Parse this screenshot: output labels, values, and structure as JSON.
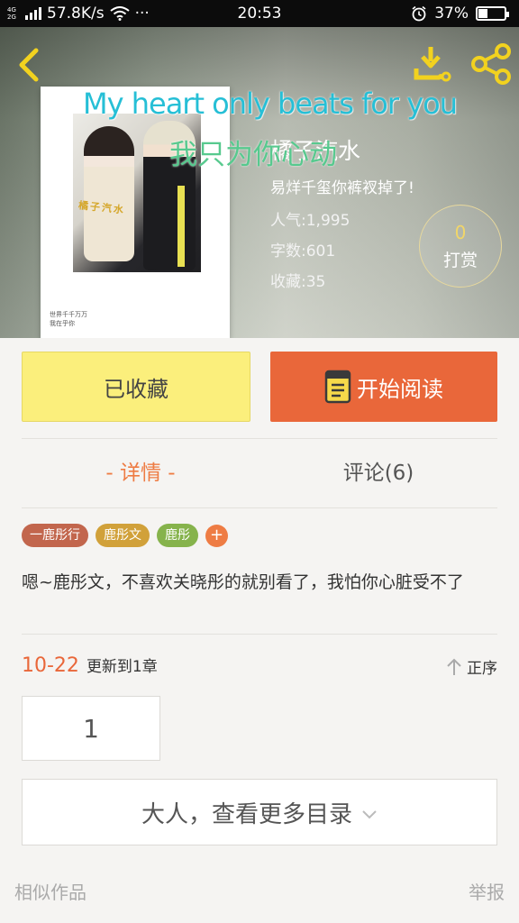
{
  "status_bar": {
    "network_labels": [
      "4G",
      "2G"
    ],
    "speed": "57.8K/s",
    "dots": "···",
    "time": "20:53",
    "battery": "37%",
    "battery_level": 0.37
  },
  "header": {
    "overlay_text_en": "My heart only beats for you",
    "overlay_text_cn": "我只为你心动",
    "title": "橘子汽水",
    "author": "易烊千玺你裤衩掉了!",
    "stats": [
      {
        "label": "人气:",
        "value": "1,995"
      },
      {
        "label": "字数:",
        "value": "601"
      },
      {
        "label": "收藏:",
        "value": "35"
      }
    ],
    "reward": {
      "count": "0",
      "label": "打赏"
    },
    "cover_caption": [
      "世界千千万万",
      "我在乎你"
    ],
    "cover_title": "橘子汽水"
  },
  "actions": {
    "favorite_label": "已收藏",
    "read_label": "开始阅读"
  },
  "tabs": {
    "detail": "- 详情 -",
    "comments": "评论(6)"
  },
  "tags": [
    {
      "label": "一鹿彤行",
      "color": "#c2664d"
    },
    {
      "label": "鹿彤文",
      "color": "#d1a13a"
    },
    {
      "label": "鹿彤",
      "color": "#86b34c"
    }
  ],
  "tag_add": "+",
  "description": "嗯~鹿彤文，不喜欢关晓彤的就别看了，我怕你心脏受不了",
  "update": {
    "date": "10-22",
    "text": "更新到1章",
    "order_label": "正序"
  },
  "chapter_number": "1",
  "more_catalog": "大人，查看更多目录",
  "footer": {
    "similar": "相似作品",
    "report": "举报"
  },
  "colors": {
    "accent": "#e9673a",
    "favorite_bg": "#fbef7c",
    "icon_yellow": "#f2d21f"
  }
}
